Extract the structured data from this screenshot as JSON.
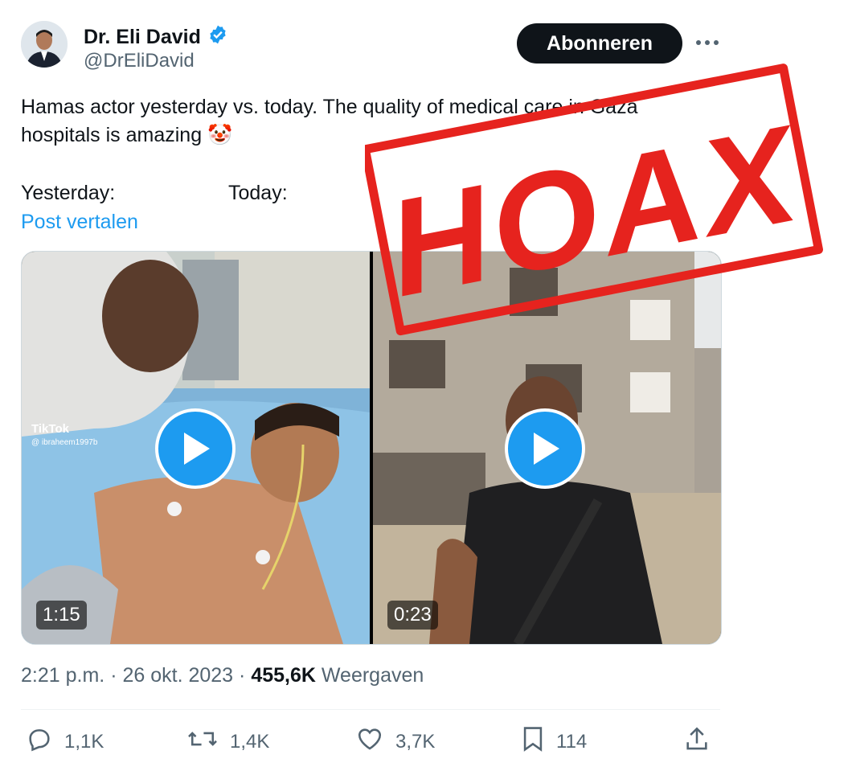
{
  "author": {
    "name": "Dr. Eli David",
    "handle": "@DrEliDavid",
    "verified": true
  },
  "header": {
    "subscribe_label": "Abonneren"
  },
  "tweet": {
    "line1": "Hamas actor yesterday vs. today. The quality of medical care in Gaza",
    "line2": "hospitals is amazing 🤡",
    "yesterday_label": "Yesterday:",
    "today_label": "Today:",
    "translate_label": "Post vertalen"
  },
  "media": {
    "video1": {
      "duration": "1:15",
      "watermark_brand": "TikTok",
      "watermark_user": "@ ibraheem1997b"
    },
    "video2": {
      "duration": "0:23"
    }
  },
  "meta": {
    "time": "2:21 p.m.",
    "date": "26 okt. 2023",
    "views_count": "455,6K",
    "views_label": "Weergaven"
  },
  "actions": {
    "replies": "1,1K",
    "reposts": "1,4K",
    "likes": "3,7K",
    "bookmarks": "114"
  },
  "stamp": {
    "text": "HOAX",
    "color": "#e6231e"
  },
  "colors": {
    "accent": "#1d9bf0",
    "text": "#0f1419",
    "muted": "#536471"
  }
}
